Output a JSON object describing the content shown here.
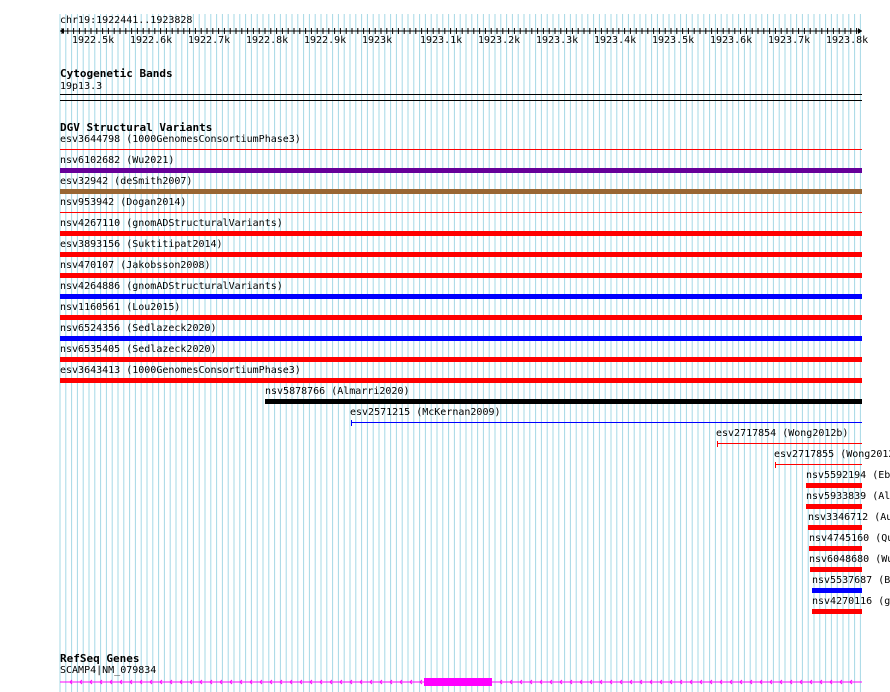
{
  "ruler": {
    "position_label": "chr19:1922441..1923828",
    "ticks": [
      "1922.5k",
      "1922.6k",
      "1922.7k",
      "1922.8k",
      "1922.9k",
      "1923k",
      "1923.1k",
      "1923.2k",
      "1923.3k",
      "1923.4k",
      "1923.5k",
      "1923.6k",
      "1923.7k",
      "1923.8k"
    ]
  },
  "cytoband": {
    "title": "Cytogenetic Bands",
    "band_label": "19p13.3"
  },
  "dgv": {
    "title": "DGV Structural Variants",
    "variants": [
      {
        "label": "esv3644798 (1000GenomesConsortiumPhase3)",
        "color": "#ff0000",
        "style": "thin"
      },
      {
        "label": "nsv6102682 (Wu2021)",
        "color": "#660099",
        "style": "thick"
      },
      {
        "label": "esv32942 (deSmith2007)",
        "color": "#996633",
        "style": "thick"
      },
      {
        "label": "nsv953942 (Dogan2014)",
        "color": "#ff0000",
        "style": "thin"
      },
      {
        "label": "nsv4267110 (gnomADStructuralVariants)",
        "color": "#ff0000",
        "style": "thick"
      },
      {
        "label": "esv3893156 (Suktitipat2014)",
        "color": "#ff0000",
        "style": "thick"
      },
      {
        "label": "nsv470107 (Jakobsson2008)",
        "color": "#ff0000",
        "style": "thick"
      },
      {
        "label": "nsv4264886 (gnomADStructuralVariants)",
        "color": "#0000ff",
        "style": "thick"
      },
      {
        "label": "nsv1160561 (Lou2015)",
        "color": "#ff0000",
        "style": "thick"
      },
      {
        "label": "nsv6524356 (Sedlazeck2020)",
        "color": "#0000ff",
        "style": "thick"
      },
      {
        "label": "nsv6535405 (Sedlazeck2020)",
        "color": "#ff0000",
        "style": "thick"
      },
      {
        "label": "esv3643413 (1000GenomesConsortiumPhase3)",
        "color": "#ff0000",
        "style": "thick"
      },
      {
        "label": "nsv5878766 (Almarri2020)",
        "color": "#000000",
        "style": "thick"
      },
      {
        "label": "esv2571215 (McKernan2009)",
        "color": "#0000ff",
        "style": "thin"
      },
      {
        "label": "esv2717854 (Wong2012b)",
        "color": "#ff0000",
        "style": "thin"
      },
      {
        "label": "esv2717855 (Wong2012",
        "color": "#ff0000",
        "style": "thin"
      },
      {
        "label": "nsv5592194 (Eb",
        "color": "#ff0000",
        "style": "thick"
      },
      {
        "label": "nsv5933839 (Al",
        "color": "#ff0000",
        "style": "thick"
      },
      {
        "label": "nsv3346712 (Au",
        "color": "#ff0000",
        "style": "thick"
      },
      {
        "label": "nsv4745160 (Qu",
        "color": "#ff0000",
        "style": "thick"
      },
      {
        "label": "nsv6048680 (Wu",
        "color": "#ff0000",
        "style": "thick"
      },
      {
        "label": "nsv5537687 (B",
        "color": "#0000ff",
        "style": "thick"
      },
      {
        "label": "nsv4270116 (g",
        "color": "#ff0000",
        "style": "thick"
      }
    ]
  },
  "refseq": {
    "title": "RefSeq Genes",
    "gene_label": "SCAMP4|NM_079834",
    "gene_color": "#ff00ff"
  },
  "colors": {
    "grid": "#a6d8e6",
    "section_rule": "#000000",
    "variant_separator": "#ff0000"
  }
}
